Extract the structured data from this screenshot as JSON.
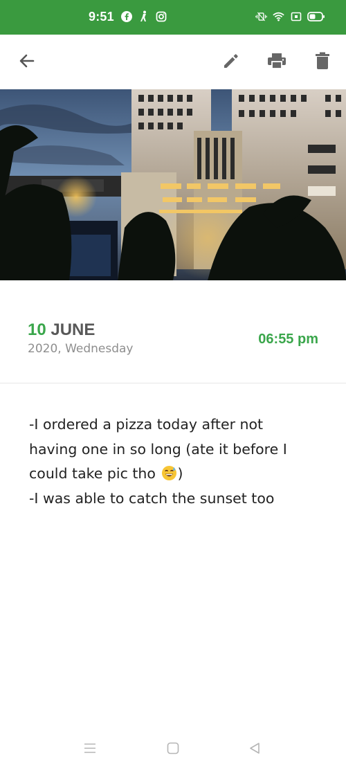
{
  "status_bar": {
    "time": "9:51",
    "left_icons": [
      "facebook-icon",
      "notification-icon",
      "instagram-icon"
    ],
    "right_icons": [
      "vibrate-icon",
      "wifi-icon",
      "sim-icon",
      "battery-icon"
    ],
    "background": "#3a9a3f"
  },
  "toolbar": {
    "icons": [
      "back-arrow-icon",
      "edit-icon",
      "print-icon",
      "delete-icon"
    ]
  },
  "entry": {
    "day": "10",
    "month": "JUNE",
    "sub_date": "2020, Wednesday",
    "time": "06:55 pm",
    "lines": [
      "-I ordered a pizza today after not",
      "having one in so long (ate it before I",
      "could take pic tho",
      ")",
      "-I was able to catch the sunset too"
    ]
  },
  "nav_bar": {
    "icons": [
      "menu-icon",
      "home-icon",
      "back-triangle-icon"
    ]
  },
  "colors": {
    "accent": "#3aa64b",
    "text": "#222222",
    "muted": "#8e8e8e"
  }
}
